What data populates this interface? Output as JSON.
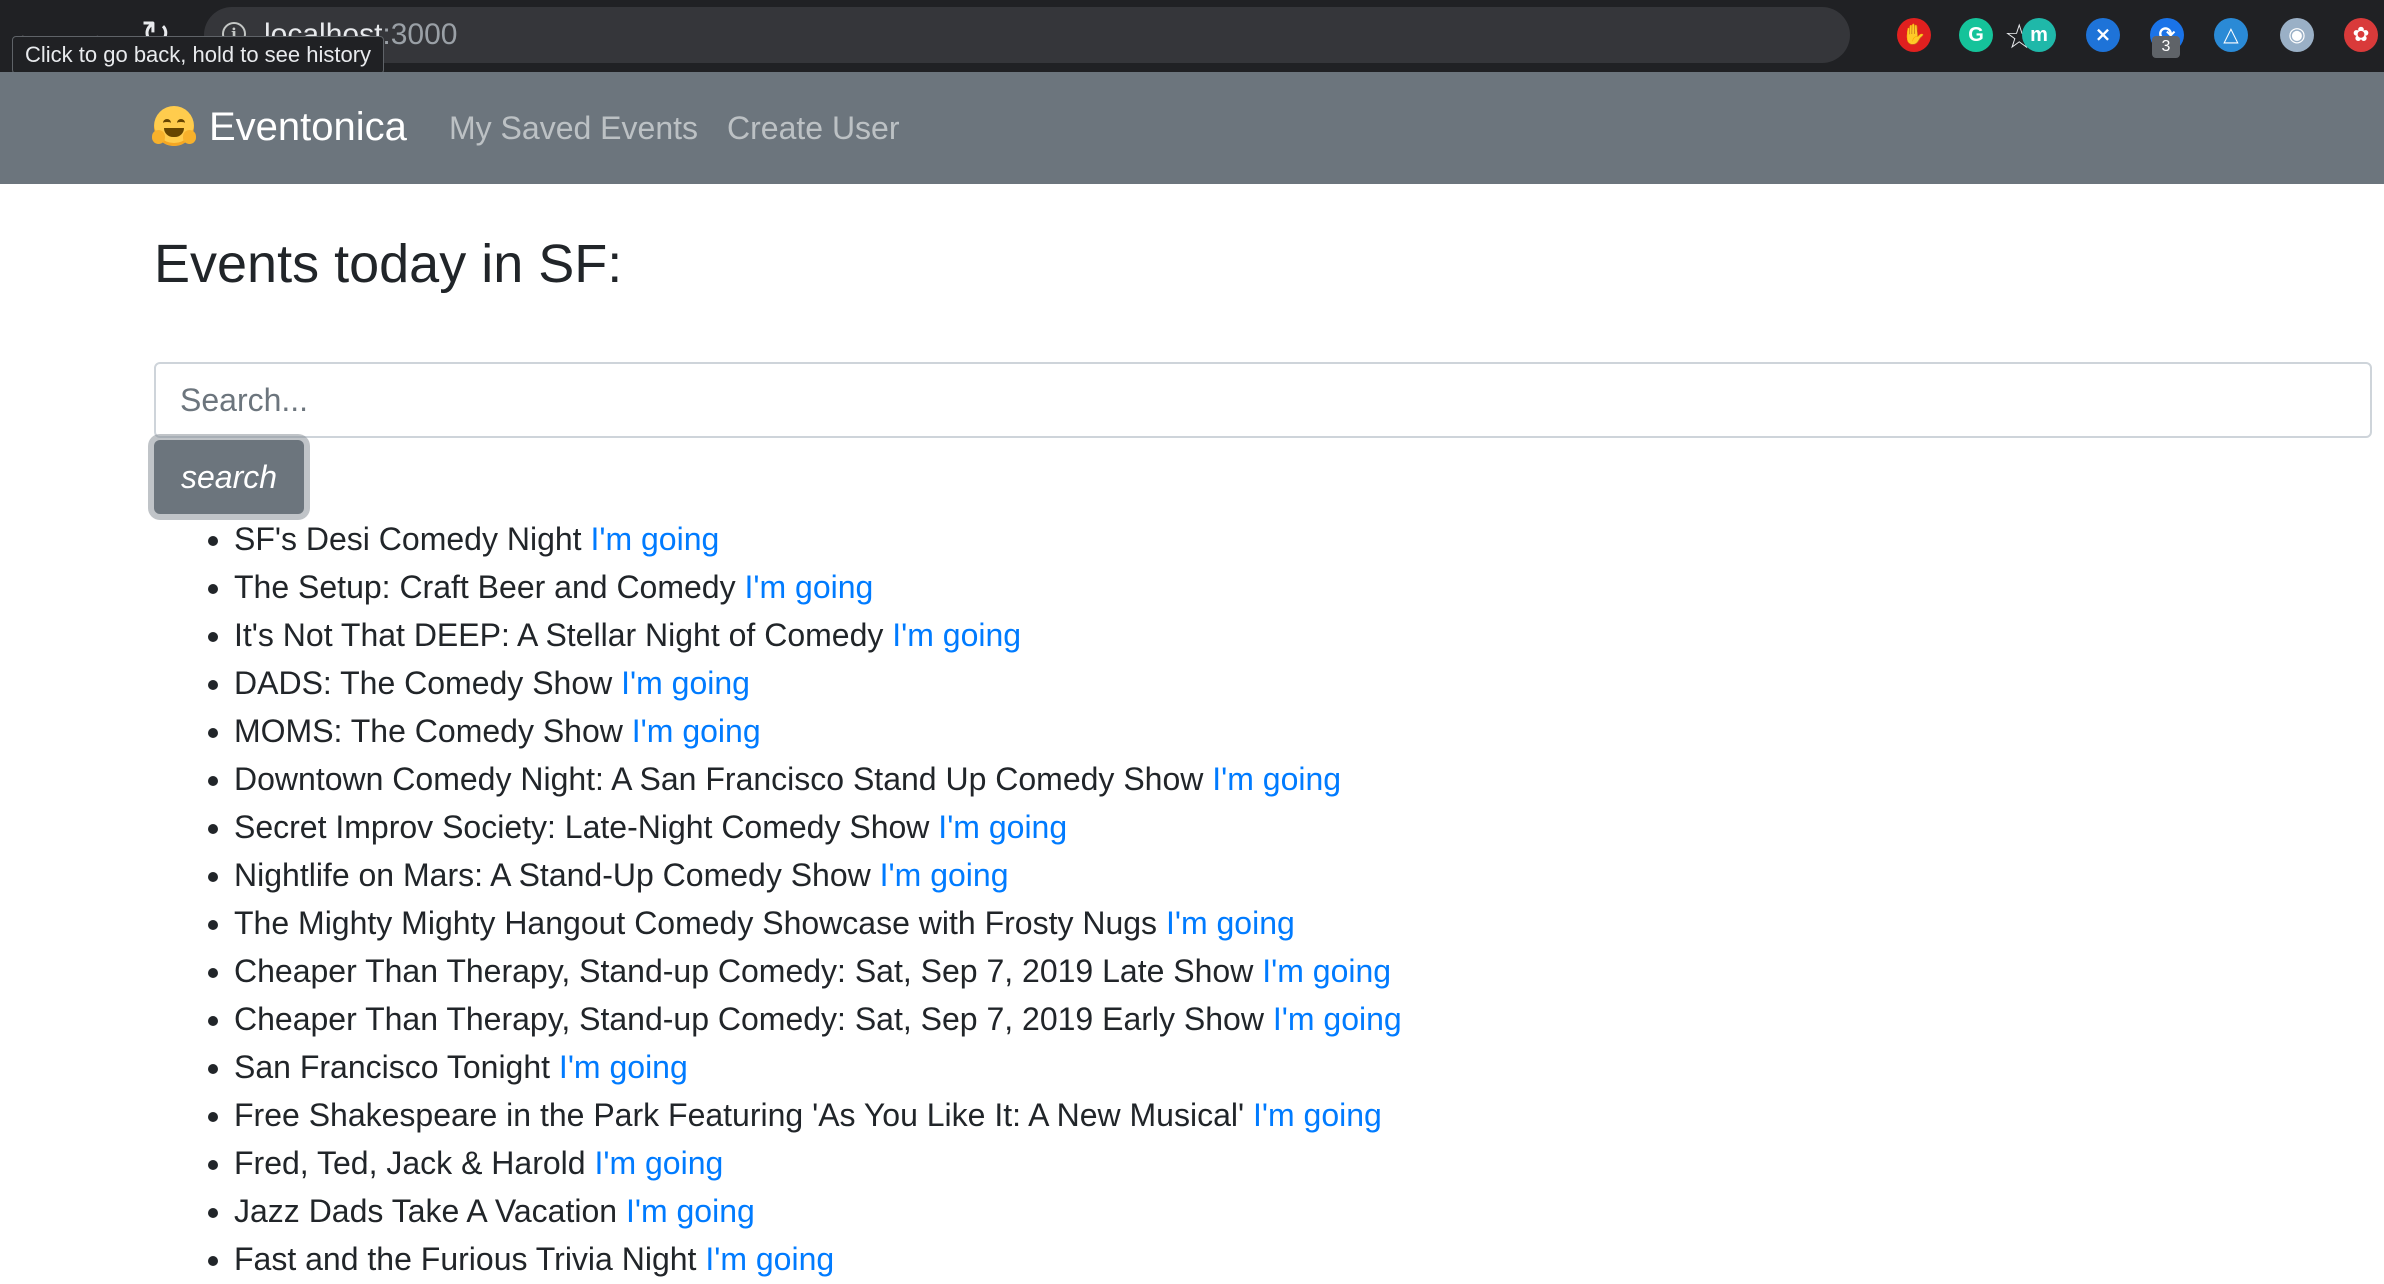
{
  "browser": {
    "url_host": "localhost",
    "url_port": ":3000",
    "tooltip": "Click to go back, hold to see history",
    "back_icon": "arrow-left-icon",
    "forward_icon": "arrow-right-icon",
    "reload_icon": "reload-icon",
    "bookmark_icon": "star-icon",
    "extensions": [
      {
        "name": "adblock-extension-icon",
        "glyph": "✋",
        "color": "#e0201f"
      },
      {
        "name": "grammarly-extension-icon",
        "glyph": "G",
        "color": "#15c39a"
      },
      {
        "name": "mercury-extension-icon",
        "glyph": "m",
        "color": "#1fb8a9"
      },
      {
        "name": "vscode-extension-icon",
        "glyph": "⨯",
        "color": "#1e73d8"
      },
      {
        "name": "sync-extension-icon",
        "glyph": "⟳",
        "color": "#1a73e8"
      },
      {
        "name": "triangle-extension-icon",
        "glyph": "△",
        "color": "#2a8ad6"
      },
      {
        "name": "circle-extension-icon",
        "glyph": "◉",
        "color": "#9ab0c6"
      },
      {
        "name": "puzzle-extension-icon",
        "glyph": "✿",
        "color": "#d93a3a"
      }
    ],
    "extension_badge": "3"
  },
  "navbar": {
    "brand_icon": "hugging-face-emoji-icon",
    "brand": "Eventonica",
    "links": [
      "My Saved Events",
      "Create User"
    ]
  },
  "main": {
    "title": "Events today in SF:",
    "search_placeholder": "Search...",
    "search_button": "search",
    "going_label": "I'm going",
    "events": [
      "SF's Desi Comedy Night",
      "The Setup: Craft Beer and Comedy",
      "It's Not That DEEP: A Stellar Night of Comedy",
      "DADS: The Comedy Show",
      "MOMS: The Comedy Show",
      "Downtown Comedy Night: A San Francisco Stand Up Comedy Show",
      "Secret Improv Society: Late-Night Comedy Show",
      "Nightlife on Mars: A Stand-Up Comedy Show",
      "The Mighty Mighty Hangout Comedy Showcase with Frosty Nugs",
      "Cheaper Than Therapy, Stand-up Comedy: Sat, Sep 7, 2019 Late Show",
      "Cheaper Than Therapy, Stand-up Comedy: Sat, Sep 7, 2019 Early Show",
      "San Francisco Tonight",
      "Free Shakespeare in the Park Featuring 'As You Like It: A New Musical'",
      "Fred, Ted, Jack & Harold",
      "Jazz Dads Take A Vacation",
      "Fast and the Furious Trivia Night"
    ]
  }
}
